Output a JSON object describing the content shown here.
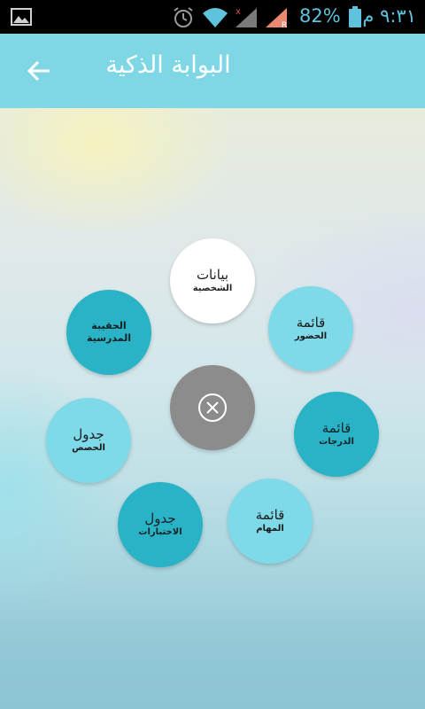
{
  "status_bar": {
    "time": "٩:٣١ م",
    "battery_percent": "82%",
    "icons": [
      "gallery-icon",
      "alarm-icon",
      "wifi-icon",
      "signal-icon",
      "signal-roaming-icon",
      "battery-icon"
    ]
  },
  "header": {
    "title": "البوابة الذكية",
    "back_icon": "arrow-left-icon"
  },
  "menu": {
    "items": [
      {
        "id": "personal-data",
        "title": "بيانات",
        "subtitle": "الشخصية",
        "style": "white"
      },
      {
        "id": "attendance-list",
        "title": "قائمة",
        "subtitle": "الحضور",
        "style": "light"
      },
      {
        "id": "grades-list",
        "title": "قائمة",
        "subtitle": "الدرجات",
        "style": "dark"
      },
      {
        "id": "tasks-list",
        "title": "قائمة",
        "subtitle": "المهام",
        "style": "light"
      },
      {
        "id": "exams-table",
        "title": "جدول",
        "subtitle": "الاختبارات",
        "style": "dark"
      },
      {
        "id": "classes-table",
        "title": "جدول",
        "subtitle": "الحصص",
        "style": "light"
      },
      {
        "id": "school-bag",
        "title": "الحقيبة",
        "subtitle": "المدرسية",
        "style": "dark"
      }
    ],
    "close_icon": "close-icon"
  },
  "colors": {
    "header_bg": "#7fd7e6",
    "bubble_light": "#7ed9e8",
    "bubble_dark": "#2ab3c6",
    "center_button": "#8c8c8c",
    "status_text": "#5fc3dd"
  }
}
